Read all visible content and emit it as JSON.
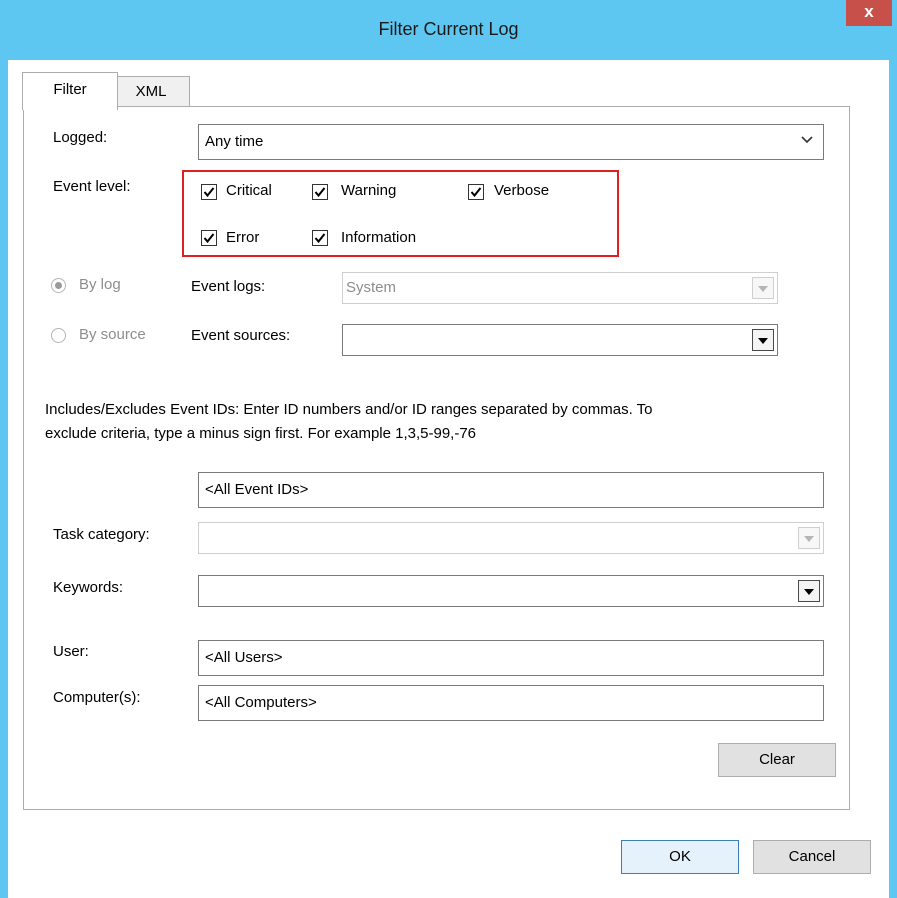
{
  "window": {
    "title": "Filter Current Log",
    "close_label": "x"
  },
  "tabs": [
    {
      "label": "Filter",
      "active": true
    },
    {
      "label": "XML",
      "active": false
    }
  ],
  "logged": {
    "label": "Logged:",
    "value": "Any time"
  },
  "event_level": {
    "label": "Event level:",
    "levels": [
      {
        "label": "Critical",
        "checked": true
      },
      {
        "label": "Warning",
        "checked": true
      },
      {
        "label": "Verbose",
        "checked": true
      },
      {
        "label": "Error",
        "checked": true
      },
      {
        "label": "Information",
        "checked": true
      }
    ]
  },
  "by_log": {
    "label": "By log",
    "selected": true,
    "enabled": false
  },
  "by_source": {
    "label": "By source",
    "selected": false,
    "enabled": false
  },
  "event_logs": {
    "label": "Event logs:",
    "value": "System"
  },
  "event_sources": {
    "label": "Event sources:",
    "value": ""
  },
  "event_ids": {
    "help_line1": "Includes/Excludes Event IDs: Enter ID numbers and/or ID ranges separated by commas. To",
    "help_line2": "exclude criteria, type a minus sign first. For example 1,3,5-99,-76",
    "value": "<All Event IDs>"
  },
  "task_category": {
    "label": "Task category:",
    "value": ""
  },
  "keywords": {
    "label": "Keywords:",
    "value": ""
  },
  "user": {
    "label": "User:",
    "value": "<All Users>"
  },
  "computers": {
    "label": "Computer(s):",
    "value": "<All Computers>"
  },
  "buttons": {
    "clear": "Clear",
    "ok": "OK",
    "cancel": "Cancel"
  },
  "colors": {
    "titlebar": "#5ec7f1",
    "close": "#c7504a",
    "highlight": "#e02020"
  }
}
